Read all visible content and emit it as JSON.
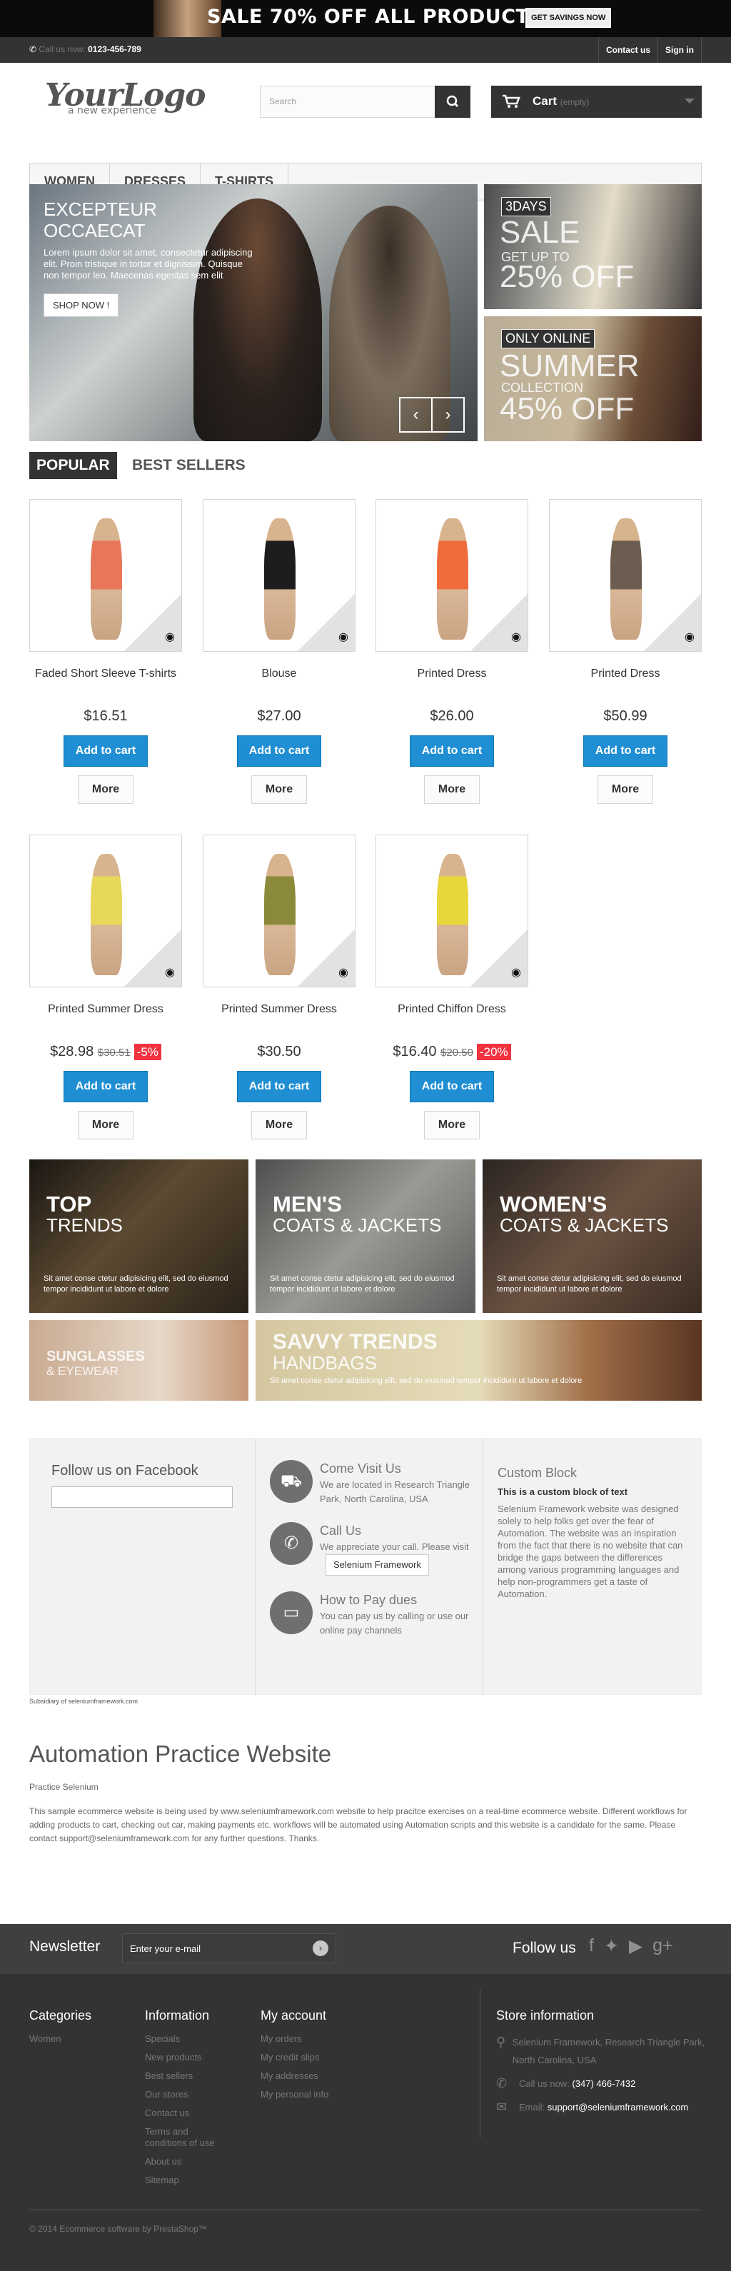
{
  "top_banner": {
    "sale_text": "SALE 70% OFF ALL PRODUCTS",
    "cta": "GET SAVINGS NOW"
  },
  "nav": {
    "call_label": "Call us now:",
    "phone": "0123-456-789",
    "contact": "Contact us",
    "signin": "Sign in"
  },
  "logo": {
    "main": "YourLogo",
    "tag": "a new experience"
  },
  "search": {
    "placeholder": "Search"
  },
  "cart": {
    "label": "Cart",
    "status": "(empty)"
  },
  "menu": [
    "WOMEN",
    "DRESSES",
    "T-SHIRTS"
  ],
  "slider": {
    "title1": "EXCEPTEUR",
    "title2": "OCCAECAT",
    "text": "Lorem ipsum dolor sit amet, consectetur adipiscing elit. Proin tristique in tortor et dignissim. Quisque non tempor leo. Maecenas egestas sem elit",
    "button": "SHOP NOW !"
  },
  "banner1": {
    "tag": "3DAYS",
    "big": "SALE",
    "small": "GET UP TO",
    "pct": "25% OFF"
  },
  "banner2": {
    "tag": "ONLY ONLINE",
    "big": "SUMMER",
    "small": "COLLECTION",
    "pct": "45% OFF"
  },
  "tabs": {
    "popular": "POPULAR",
    "best": "BEST SELLERS"
  },
  "products": [
    {
      "name": "Faded Short Sleeve T-shirts",
      "price": "$16.51",
      "old": "",
      "reduction": "",
      "color": "#e8775a"
    },
    {
      "name": "Blouse",
      "price": "$27.00",
      "old": "",
      "reduction": "",
      "color": "#1c1c1c"
    },
    {
      "name": "Printed Dress",
      "price": "$26.00",
      "old": "",
      "reduction": "",
      "color": "#ef6b3c"
    },
    {
      "name": "Printed Dress",
      "price": "$50.99",
      "old": "",
      "reduction": "",
      "color": "#6b5d4f"
    },
    {
      "name": "Printed Summer Dress",
      "price": "$28.98",
      "old": "$30.51",
      "reduction": "-5%",
      "color": "#e8d85a"
    },
    {
      "name": "Printed Summer Dress",
      "price": "$30.50",
      "old": "",
      "reduction": "",
      "color": "#8a8a3a"
    },
    {
      "name": "Printed Chiffon Dress",
      "price": "$16.40",
      "old": "$20.50",
      "reduction": "-20%",
      "color": "#e8d63a"
    }
  ],
  "product_buttons": {
    "add": "Add to cart",
    "more": "More"
  },
  "promos": [
    {
      "h1": "TOP",
      "h2": "TRENDS",
      "p": "Sit amet conse ctetur adipisicing elit, sed do eiusmod tempor incididunt ut labore et dolore"
    },
    {
      "h1": "MEN'S",
      "h2": "COATS & JACKETS",
      "p": "Sit amet conse ctetur adipisicing elit, sed do eiusmod tempor incididunt ut labore et dolore"
    },
    {
      "h1": "WOMEN'S",
      "h2": "COATS & JACKETS",
      "p": "Sit amet conse ctetur adipisicing elit, sed do eiusmod tempor incididunt ut labore et dolore"
    },
    {
      "h1": "SUNGLASSES",
      "h2": "& EYEWEAR",
      "p": ""
    },
    {
      "h1": "SAVVY TRENDS",
      "h2": "HANDBAGS",
      "p": "Sit amet conse ctetur adipisicing elit, sed do eiusmod tempor incididunt ut labore et dolore"
    }
  ],
  "facebook": {
    "title": "Follow us on Facebook"
  },
  "cms": [
    {
      "title": "Come Visit Us",
      "text": "We are located in Research Triangle Park, North Carolina, USA"
    },
    {
      "title": "Call Us",
      "text": "We appreciate your call. Please visit",
      "button": "Selenium Framework"
    },
    {
      "title": "How to Pay dues",
      "text": "You can pay us by calling or use our online pay channels"
    }
  ],
  "custom_block": {
    "title": "Custom Block",
    "bold": "This is a custom block of text",
    "text": "Selenium Framework website was designed solely to help folks get over the fear of Automation. The website was an inspiration from the fact that there is no website that can bridge the gaps between the differences among various programming languages and help non-programmers get a taste of Automation."
  },
  "subsidiary": "Subsidiary of seleniumframework.com",
  "automation": {
    "title": "Automation Practice Website",
    "sub": "Practice Selenium",
    "para": "This sample ecommerce website is being used by www.seleniumframework.com website to help pracitce exercises on a real-time ecommerce website. Different workflows for adding products to cart, checking out car, making payments etc. workflows will be automated using Automation scripts and this website is a candidate for the same. Please contact support@seleniumframework.com for any further questions. Thanks."
  },
  "newsletter": {
    "label": "Newsletter",
    "placeholder": "Enter your e-mail",
    "follow": "Follow us"
  },
  "footer": {
    "categories": {
      "title": "Categories",
      "items": [
        "Women"
      ]
    },
    "information": {
      "title": "Information",
      "items": [
        "Specials",
        "New products",
        "Best sellers",
        "Our stores",
        "Contact us",
        "Terms and conditions of use",
        "About us",
        "Sitemap"
      ]
    },
    "account": {
      "title": "My account",
      "items": [
        "My orders",
        "My credit slips",
        "My addresses",
        "My personal info"
      ]
    },
    "store": {
      "title": "Store information",
      "address": "Selenium Framework, Research Triangle Park, North Carolina, USA",
      "call_label": "Call us now:",
      "phone": "(347) 466-7432",
      "email_label": "Email:",
      "email": "support@seleniumframework.com"
    },
    "copyright": "© 2014 Ecommerce software by PrestaShop™"
  }
}
